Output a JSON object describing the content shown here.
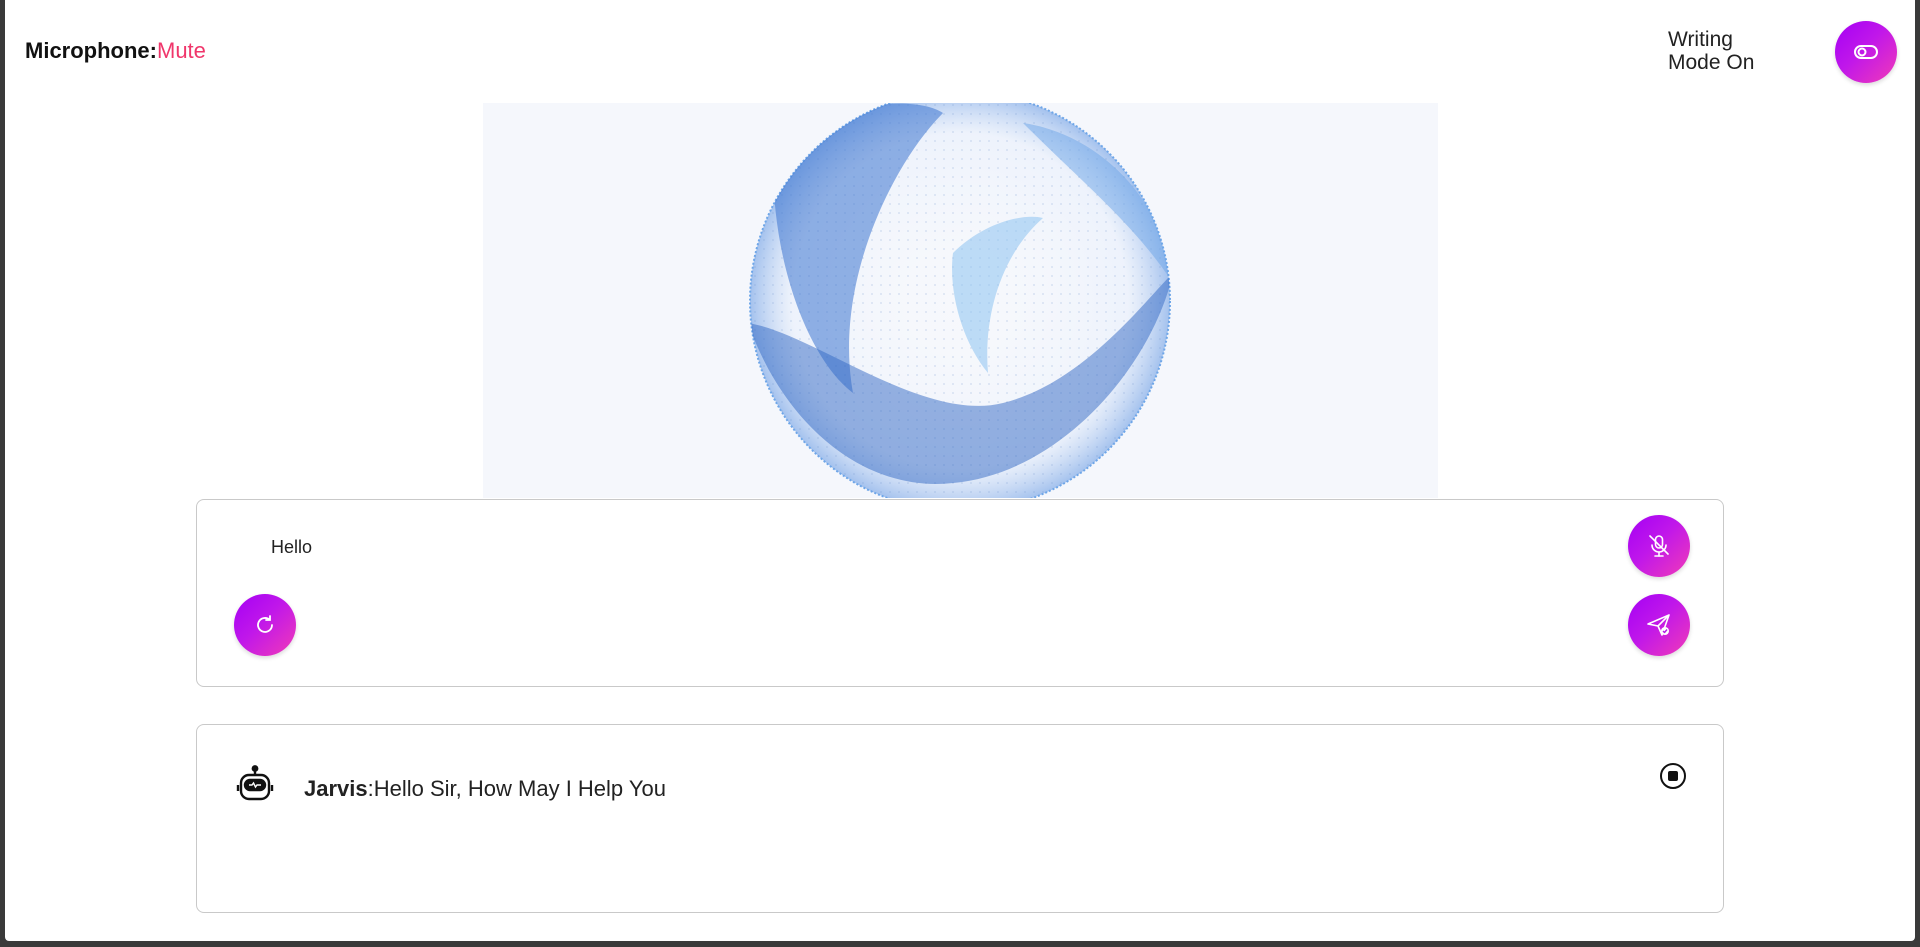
{
  "header": {
    "mic_label": "Microphone:",
    "mic_state": "Mute",
    "mode_label": "Writing Mode On",
    "toggle_icon": "toggle-icon"
  },
  "input": {
    "value": "Hello",
    "placeholder": "",
    "mic_icon": "mic-off-icon",
    "send_icon": "send-icon",
    "reset_icon": "refresh-icon"
  },
  "reply": {
    "speaker": "Jarvis",
    "separator": ":",
    "message": "Hello Sir, How May I Help You",
    "avatar_icon": "robot-icon",
    "stop_icon": "stop-icon"
  },
  "colors": {
    "accent_start": "#a400f5",
    "accent_end": "#f13bb7",
    "mute_red": "#f0366b",
    "visual_bg": "#f5f7fc"
  }
}
